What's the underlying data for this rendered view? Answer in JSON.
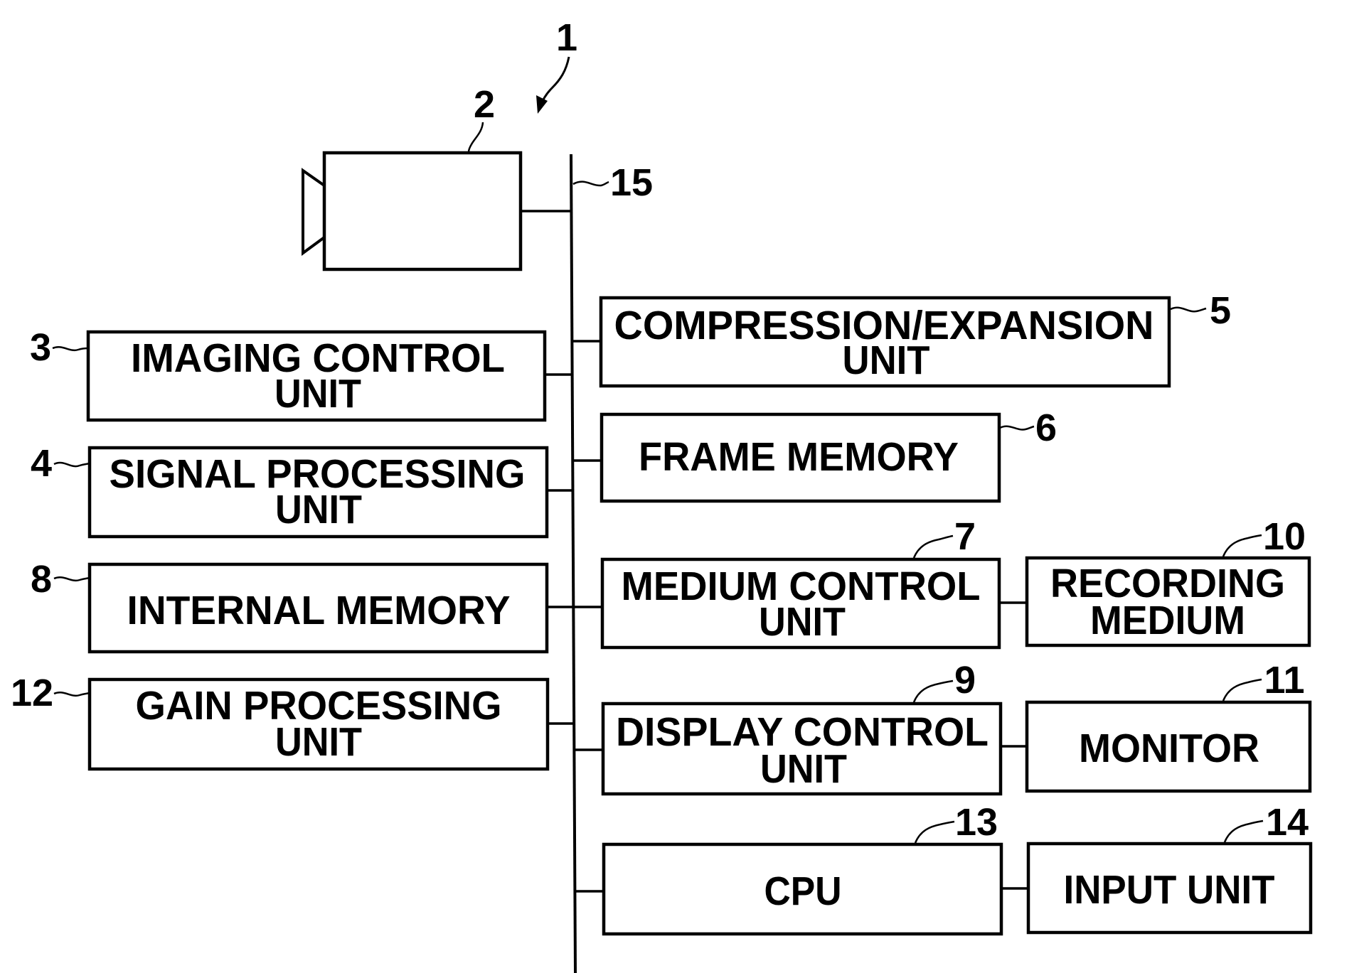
{
  "diagram": {
    "system_ref": "1",
    "bus_ref": "15",
    "camera": {
      "ref": "2",
      "name": "imaging unit (camera)"
    },
    "blocks": {
      "imaging_control": {
        "ref": "3",
        "lines": [
          "IMAGING CONTROL",
          "UNIT"
        ]
      },
      "signal_processing": {
        "ref": "4",
        "lines": [
          "SIGNAL PROCESSING",
          "UNIT"
        ]
      },
      "compression_expansion": {
        "ref": "5",
        "lines": [
          "COMPRESSION/EXPANSION",
          "UNIT"
        ]
      },
      "frame_memory": {
        "ref": "6",
        "lines": [
          "FRAME MEMORY"
        ]
      },
      "medium_control": {
        "ref": "7",
        "lines": [
          "MEDIUM CONTROL",
          "UNIT"
        ]
      },
      "internal_memory": {
        "ref": "8",
        "lines": [
          "INTERNAL MEMORY"
        ]
      },
      "display_control": {
        "ref": "9",
        "lines": [
          "DISPLAY CONTROL",
          "UNIT"
        ]
      },
      "recording_medium": {
        "ref": "10",
        "lines": [
          "RECORDING",
          "MEDIUM"
        ]
      },
      "monitor": {
        "ref": "11",
        "lines": [
          "MONITOR"
        ]
      },
      "gain_processing": {
        "ref": "12",
        "lines": [
          "GAIN PROCESSING",
          "UNIT"
        ]
      },
      "cpu": {
        "ref": "13",
        "lines": [
          "CPU"
        ]
      },
      "input_unit": {
        "ref": "14",
        "lines": [
          "INPUT UNIT"
        ]
      }
    },
    "connections": [
      [
        "camera",
        "bus"
      ],
      [
        "imaging_control",
        "bus"
      ],
      [
        "signal_processing",
        "bus"
      ],
      [
        "internal_memory",
        "bus"
      ],
      [
        "gain_processing",
        "bus"
      ],
      [
        "compression_expansion",
        "bus"
      ],
      [
        "frame_memory",
        "bus"
      ],
      [
        "medium_control",
        "bus"
      ],
      [
        "display_control",
        "bus"
      ],
      [
        "cpu",
        "bus"
      ],
      [
        "medium_control",
        "recording_medium"
      ],
      [
        "display_control",
        "monitor"
      ],
      [
        "cpu",
        "input_unit"
      ]
    ]
  }
}
